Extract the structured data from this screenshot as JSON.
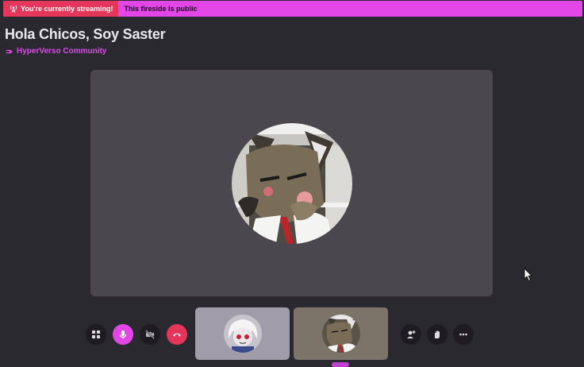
{
  "banner": {
    "streaming_label": "You're currently streaming!",
    "public_label": "This fireside is public",
    "background_color": "#e246e6",
    "live_color": "#e4365a"
  },
  "header": {
    "title": "Hola Chicos, Soy Saster",
    "community": "HyperVerso Community",
    "community_color": "#d84ee4"
  },
  "stage": {
    "main_speaker_avatar": "hyena-avatar-icon",
    "background_color": "#4a474e"
  },
  "controls_left": [
    {
      "icon": "grid-icon"
    },
    {
      "icon": "microphone-icon"
    },
    {
      "icon": "camera-off-icon"
    },
    {
      "icon": "hang-up-icon"
    }
  ],
  "participants": [
    {
      "avatar": "white-hair-character-icon"
    },
    {
      "avatar": "hyena-avatar-icon"
    }
  ],
  "controls_right": [
    {
      "icon": "add-person-icon"
    },
    {
      "icon": "raise-hand-icon"
    },
    {
      "icon": "more-options-icon"
    }
  ]
}
